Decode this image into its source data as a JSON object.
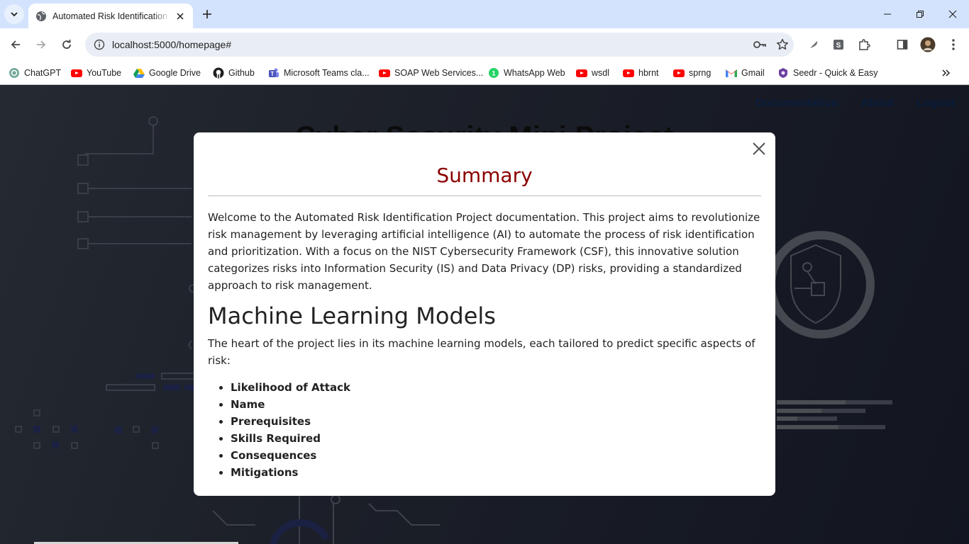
{
  "browser": {
    "tab": {
      "title": "Automated Risk Identification with"
    },
    "address": {
      "url": "localhost:5000/homepage#"
    },
    "bookmarks": [
      {
        "label": "ChatGPT",
        "icon": "chatgpt-icon"
      },
      {
        "label": "YouTube",
        "icon": "youtube-icon"
      },
      {
        "label": "Google Drive",
        "icon": "google-drive-icon"
      },
      {
        "label": "Github",
        "icon": "github-icon"
      },
      {
        "label": "Microsoft Teams cla...",
        "icon": "teams-icon"
      },
      {
        "label": "SOAP Web Services...",
        "icon": "youtube-icon"
      },
      {
        "label": "WhatsApp Web",
        "icon": "whatsapp-icon"
      },
      {
        "label": "wsdl",
        "icon": "youtube-icon"
      },
      {
        "label": "hbrnt",
        "icon": "youtube-icon"
      },
      {
        "label": "sprng",
        "icon": "youtube-icon"
      },
      {
        "label": "Gmail",
        "icon": "gmail-icon"
      },
      {
        "label": "Seedr - Quick & Easy",
        "icon": "seedr-icon"
      }
    ]
  },
  "page": {
    "nav": {
      "documentation": "Documentation",
      "about": "About",
      "logout": "Logout"
    },
    "heading": "Cyber Security Mini Project"
  },
  "modal": {
    "title": "Summary",
    "intro": "Welcome to the Automated Risk Identification Project documentation. This project aims to revolutionize risk management by leveraging artificial intelligence (AI) to automate the process of risk identification and prioritization. With a focus on the NIST Cybersecurity Framework (CSF), this innovative solution categorizes risks into Information Security (IS) and Data Privacy (DP) risks, providing a standardized approach to risk management.",
    "subtitle": "Machine Learning Models",
    "subintro": "The heart of the project lies in its machine learning models, each tailored to predict specific aspects of risk:",
    "models": [
      "Likelihood of Attack",
      "Name",
      "Prerequisites",
      "Skills Required",
      "Consequences",
      "Mitigations"
    ]
  },
  "colors": {
    "modal_title": "#8b0000",
    "nav_link": "#0d2a5a",
    "tabstrip": "#d3e3fd"
  }
}
